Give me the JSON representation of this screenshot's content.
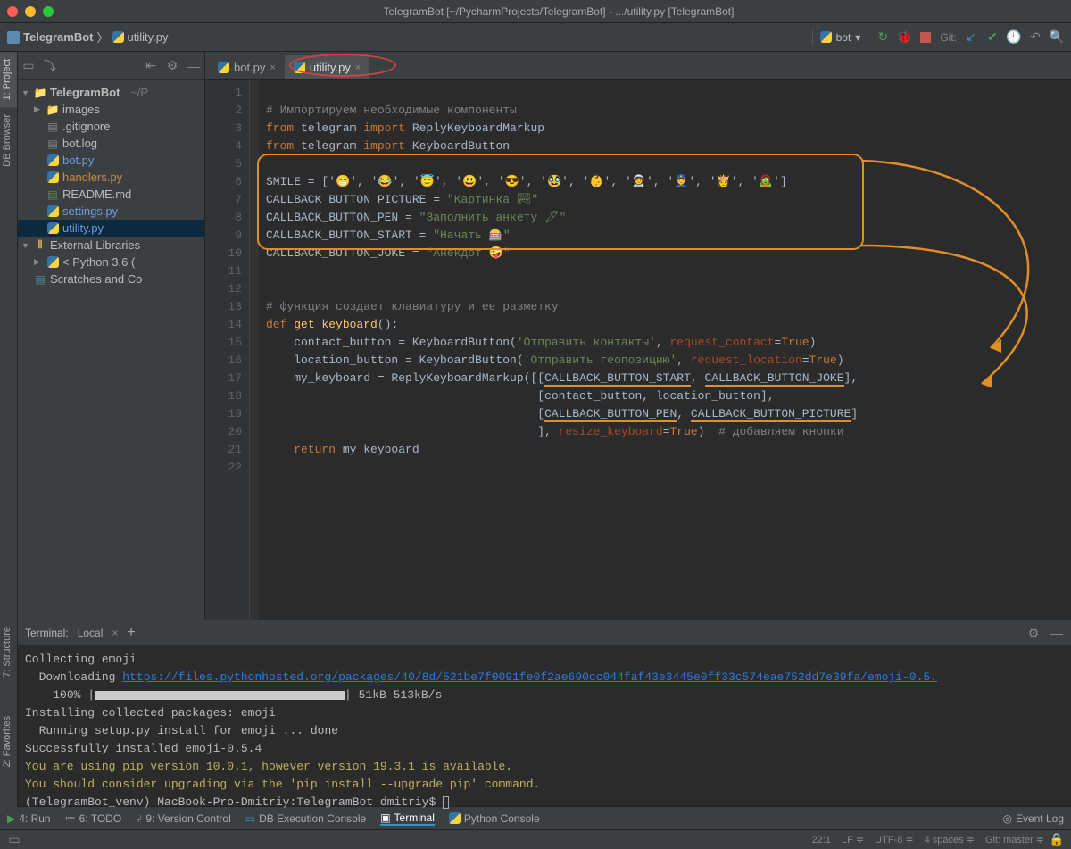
{
  "title": "TelegramBot [~/PycharmProjects/TelegramBot] - .../utility.py [TelegramBot]",
  "breadcrumb": {
    "project": "TelegramBot",
    "file": "utility.py"
  },
  "run_config": "bot",
  "git_label": "Git:",
  "left_tabs": [
    "1: Project",
    "DB Browser"
  ],
  "left_tabs2": [
    "7: Structure",
    "2: Favorites"
  ],
  "project_tree": {
    "root": "TelegramBot",
    "root_path": "~/P",
    "items": [
      {
        "name": "images",
        "type": "folder",
        "ind": 1,
        "arrow": "▶"
      },
      {
        "name": ".gitignore",
        "type": "txt",
        "ind": 2
      },
      {
        "name": "bot.log",
        "type": "txt",
        "ind": 2
      },
      {
        "name": "bot.py",
        "type": "py",
        "ind": 2,
        "cls": "git-blue"
      },
      {
        "name": "handlers.py",
        "type": "py",
        "ind": 2,
        "cls": "git-orange"
      },
      {
        "name": "README.md",
        "type": "md",
        "ind": 2
      },
      {
        "name": "settings.py",
        "type": "py",
        "ind": 2,
        "cls": "git-blue"
      },
      {
        "name": "utility.py",
        "type": "py",
        "ind": 2,
        "cls": "git-blue",
        "sel": true
      }
    ],
    "ext_lib": "External Libraries",
    "python_env": "< Python 3.6 (",
    "scratches": "Scratches and Co"
  },
  "editor_tabs": [
    {
      "label": "bot.py",
      "active": false
    },
    {
      "label": "utility.py",
      "active": true
    }
  ],
  "gutter_lines": "1\n2\n3\n4\n5\n6\n7\n8\n9\n10\n11\n12\n13\n14\n15\n16\n17\n18\n19\n20\n21\n22",
  "code": {
    "c1": "# Импортируем необходимые компоненты",
    "l2_from": "from ",
    "l2_mod": "telegram ",
    "l2_imp": "import ",
    "l2_n": "ReplyKeyboardMarkup",
    "l3_from": "from ",
    "l3_mod": "telegram ",
    "l3_imp": "import ",
    "l3_n": "KeyboardButton",
    "l5": "SMILE = ['😁', '😂', '😇', '😃', '😎', '🥸', '👶', '🧑‍🚀', '👮', '👸', '🧟']",
    "l6a": "CALLBACK_BUTTON_PICTURE = ",
    "l6b": "\"Картинка 🏞\"",
    "l7a": "CALLBACK_BUTTON_PEN = ",
    "l7b": "\"Заполнить анкету 🖊\"",
    "l8a": "CALLBACK_BUTTON_START = ",
    "l8b": "\"Начать 🎰\"",
    "l9a": "CALLBACK_BUTTON_JOKE = ",
    "l9b": "\"Анекдот 🤪\"",
    "l12": "# функция создает клавиатуру и ее разметку",
    "l13_def": "def ",
    "l13_fn": "get_keyboard",
    "l13_p": "():",
    "l14a": "    contact_button = KeyboardButton(",
    "l14s": "'Отправить контакты'",
    "l14b": ", ",
    "l14k": "request_contact",
    "l14c": "=",
    "l14t": "True",
    "l14d": ")",
    "l15a": "    location_button = KeyboardButton(",
    "l15s": "'Отправить геопозицию'",
    "l15b": ", ",
    "l15k": "request_location",
    "l15c": "=",
    "l15t": "True",
    "l15d": ")",
    "l16a": "    my_keyboard = ReplyKeyboardMarkup([[",
    "l16u1": "CALLBACK_BUTTON_START",
    "l16b": ", ",
    "l16u2": "CALLBACK_BUTTON_JOKE",
    "l16c": "],",
    "l17": "                                       [contact_button, location_button],",
    "l18a": "                                       [",
    "l18u1": "CALLBACK_BUTTON_PEN",
    "l18b": ", ",
    "l18u2": "CALLBACK_BUTTON_PICTURE",
    "l18c": "]",
    "l19a": "                                       ], ",
    "l19k": "resize_keyboard",
    "l19b": "=",
    "l19t": "True",
    "l19c": ")  ",
    "l19cmt": "# добавляем кнопки",
    "l20_ret": "    return ",
    "l20_v": "my_keyboard"
  },
  "terminal": {
    "header": "Terminal:",
    "tab": "Local",
    "l1": "Collecting emoji",
    "l2a": "  Downloading ",
    "l2b": "https://files.pythonhosted.org/packages/40/8d/521be7f0091fe0f2ae690cc044faf43e3445e0ff33c574eae752dd7e39fa/emoji-0.5.",
    "l3a": "    100% |",
    "l3b": "| 51kB 513kB/s",
    "l4": "Installing collected packages: emoji",
    "l5": "  Running setup.py install for emoji ... done",
    "l6": "Successfully installed emoji-0.5.4",
    "l7": "You are using pip version 10.0.1, however version 19.3.1 is available.",
    "l8": "You should consider upgrading via the 'pip install --upgrade pip' command.",
    "l9": "(TelegramBot_venv) MacBook-Pro-Dmitriy:TelegramBot dmitriy$ "
  },
  "bottom_tabs": {
    "run": "4: Run",
    "todo": "6: TODO",
    "vcs": "9: Version Control",
    "db": "DB Execution Console",
    "term": "Terminal",
    "pycon": "Python Console",
    "eventlog": "Event Log"
  },
  "status": {
    "pos": "22:1",
    "lf": "LF",
    "enc": "UTF-8",
    "indent": "4 spaces",
    "git": "Git: master"
  }
}
